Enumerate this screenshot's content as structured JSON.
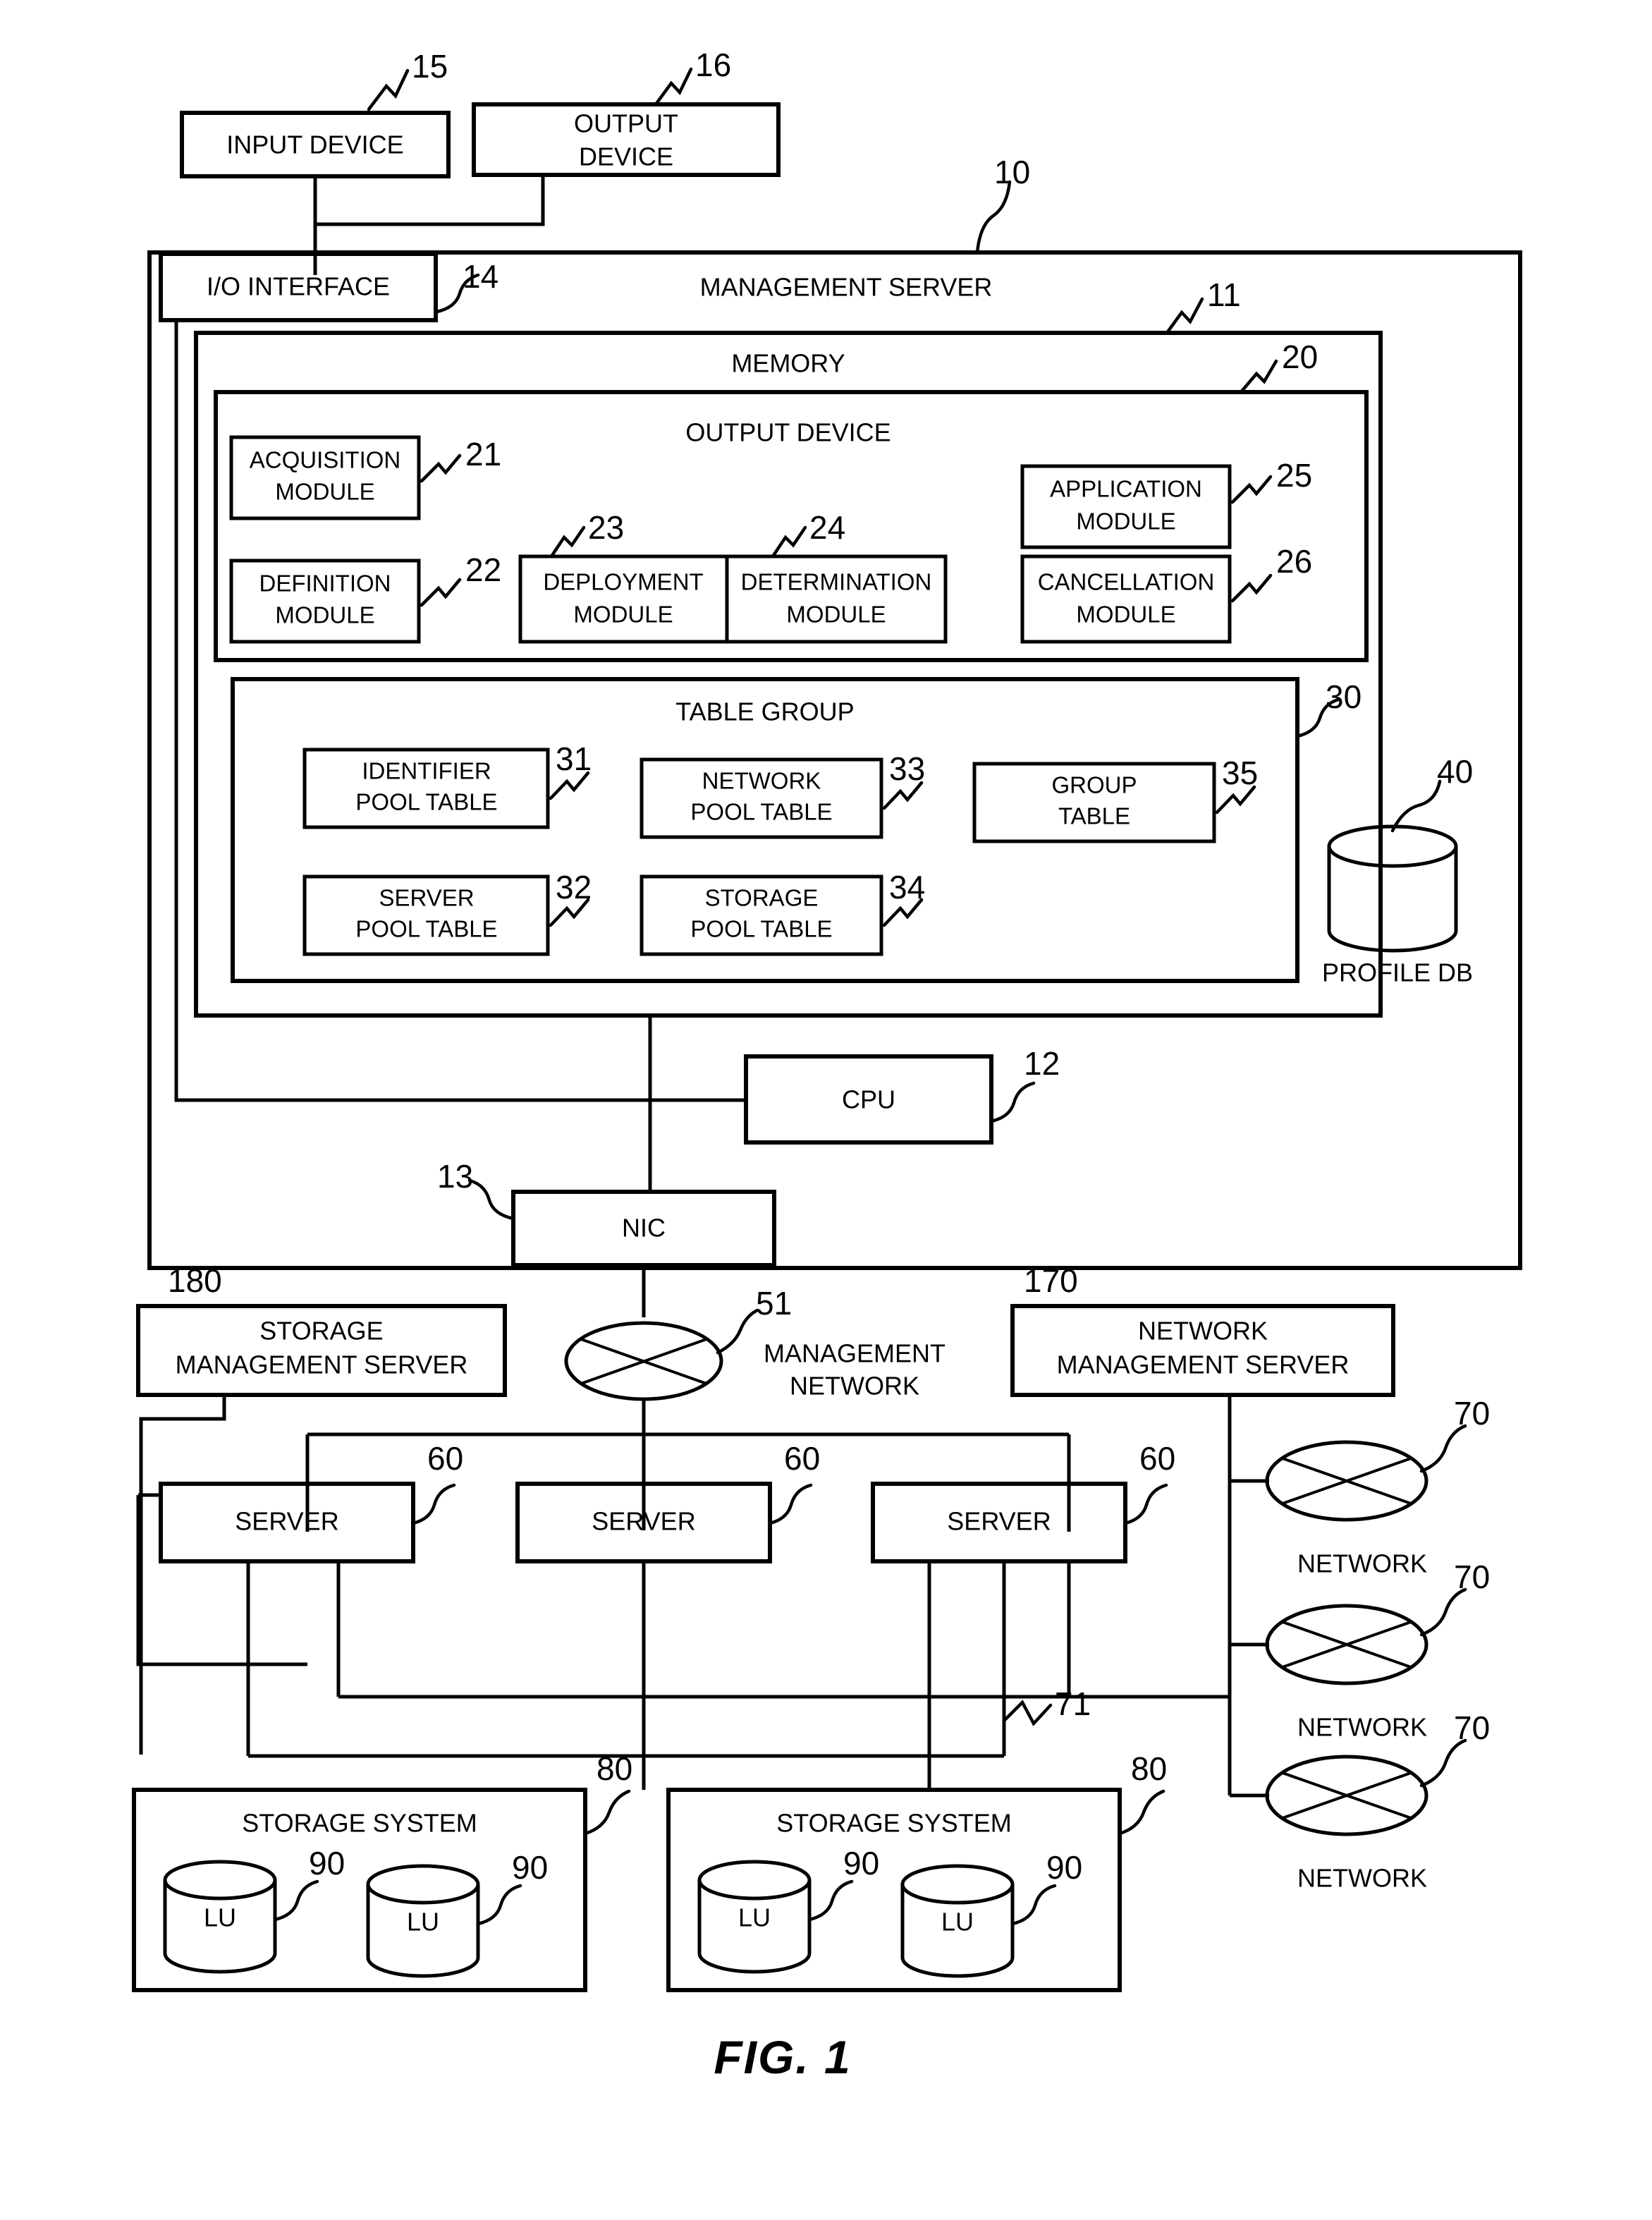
{
  "figure": {
    "caption": "FIG. 1",
    "title": "Management server system configuration diagram"
  },
  "top_devices": [
    {
      "label": "INPUT DEVICE",
      "ref": "15"
    },
    {
      "label_line1": "OUTPUT",
      "label_line2": "DEVICE",
      "ref": "16"
    }
  ],
  "management_server": {
    "label": "MANAGEMENT SERVER",
    "ref": "10",
    "io_interface": {
      "label": "I/O INTERFACE",
      "ref": "14"
    },
    "memory": {
      "label": "MEMORY",
      "ref": "11",
      "module_group": {
        "label": "OUTPUT DEVICE",
        "ref": "20",
        "modules": [
          {
            "line1": "ACQUISITION",
            "line2": "MODULE",
            "ref": "21"
          },
          {
            "line1": "DEFINITION",
            "line2": "MODULE",
            "ref": "22"
          },
          {
            "line1": "DEPLOYMENT",
            "line2": "MODULE",
            "ref": "23"
          },
          {
            "line1": "DETERMINATION",
            "line2": "MODULE",
            "ref": "24"
          },
          {
            "line1": "APPLICATION",
            "line2": "MODULE",
            "ref": "25"
          },
          {
            "line1": "CANCELLATION",
            "line2": "MODULE",
            "ref": "26"
          }
        ]
      },
      "table_group": {
        "label": "TABLE GROUP",
        "ref": "30",
        "tables": [
          {
            "line1": "IDENTIFIER",
            "line2": "POOL TABLE",
            "ref": "31"
          },
          {
            "line1": "SERVER",
            "line2": "POOL TABLE",
            "ref": "32"
          },
          {
            "line1": "NETWORK",
            "line2": "POOL TABLE",
            "ref": "33"
          },
          {
            "line1": "STORAGE",
            "line2": "POOL TABLE",
            "ref": "34"
          },
          {
            "line1": "GROUP",
            "line2": "TABLE",
            "ref": "35"
          }
        ]
      },
      "profile_db": {
        "label": "PROFILE DB",
        "ref": "40"
      }
    },
    "cpu": {
      "label": "CPU",
      "ref": "12"
    },
    "nic": {
      "label": "NIC",
      "ref": "13"
    }
  },
  "management_network": {
    "line1": "MANAGEMENT",
    "line2": "NETWORK",
    "ref": "51"
  },
  "storage_management_server": {
    "line1": "STORAGE",
    "line2": "MANAGEMENT SERVER",
    "ref": "180"
  },
  "network_management_server": {
    "line1": "NETWORK",
    "line2": "MANAGEMENT SERVER",
    "ref": "170"
  },
  "servers": [
    {
      "label": "SERVER",
      "ref": "60"
    },
    {
      "label": "SERVER",
      "ref": "60"
    },
    {
      "label": "SERVER",
      "ref": "60"
    }
  ],
  "networks": [
    {
      "label": "NETWORK",
      "ref": "70"
    },
    {
      "label": "NETWORK",
      "ref": "70"
    },
    {
      "label": "NETWORK",
      "ref": "70"
    }
  ],
  "data_network_ref": "71",
  "storage_systems": [
    {
      "label": "STORAGE SYSTEM",
      "ref": "80",
      "lus": [
        {
          "label": "LU",
          "ref": "90"
        },
        {
          "label": "LU",
          "ref": "90"
        }
      ]
    },
    {
      "label": "STORAGE SYSTEM",
      "ref": "80",
      "lus": [
        {
          "label": "LU",
          "ref": "90"
        },
        {
          "label": "LU",
          "ref": "90"
        }
      ]
    }
  ]
}
